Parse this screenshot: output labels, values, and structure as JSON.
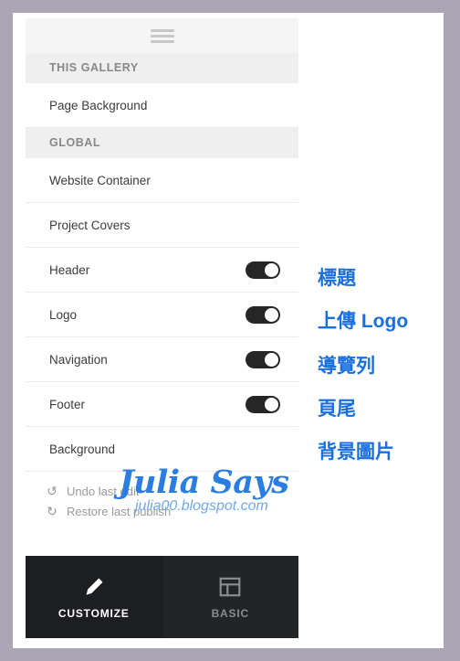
{
  "panel": {
    "menu_icon": "hamburger-icon",
    "sections": [
      {
        "title": "THIS GALLERY",
        "rows": [
          {
            "label": "Page Background",
            "toggle": false
          }
        ]
      },
      {
        "title": "GLOBAL",
        "rows": [
          {
            "label": "Website Container",
            "toggle": false
          },
          {
            "label": "Project Covers",
            "toggle": false
          },
          {
            "label": "Header",
            "toggle": true
          },
          {
            "label": "Logo",
            "toggle": true
          },
          {
            "label": "Navigation",
            "toggle": true
          },
          {
            "label": "Footer",
            "toggle": true
          },
          {
            "label": "Background",
            "toggle": false
          }
        ]
      }
    ],
    "actions": [
      {
        "icon": "undo-icon",
        "glyph": "↺",
        "label": "Undo last edit"
      },
      {
        "icon": "history-icon",
        "glyph": "↻",
        "label": "Restore last publish"
      }
    ]
  },
  "tabbar": {
    "tabs": [
      {
        "label": "CUSTOMIZE",
        "icon": "pencil-icon",
        "active": true
      },
      {
        "label": "BASIC",
        "icon": "layout-icon",
        "active": false
      }
    ]
  },
  "annotations": [
    {
      "text": "標題",
      "target": "Header"
    },
    {
      "text": "上傳 Logo",
      "target": "Logo"
    },
    {
      "text": "導覽列",
      "target": "Navigation"
    },
    {
      "text": "頁尾",
      "target": "Footer"
    },
    {
      "text": "背景圖片",
      "target": "Background"
    }
  ],
  "watermark": {
    "title": "Julia Says",
    "url": "julia00.blogspot.com"
  },
  "colors": {
    "frame": "#aba5b5",
    "accent_blue": "#1a6fe0",
    "toggle_on": "#262626",
    "tabbar": "#232427",
    "section_band": "#efefef"
  }
}
